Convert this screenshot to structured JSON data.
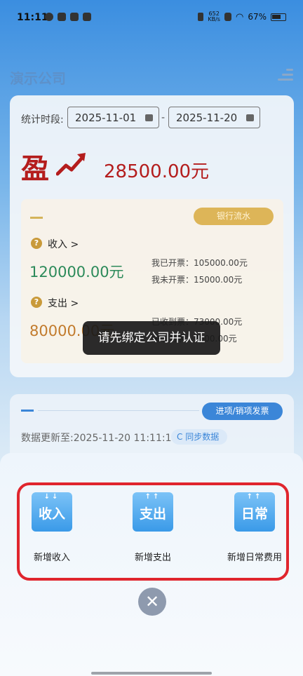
{
  "status_bar": {
    "time": "11:11",
    "net_speed_top": "652",
    "net_speed_bottom": "KB/s",
    "battery": "67%"
  },
  "header": {
    "company": "演示公司"
  },
  "summary": {
    "period_label": "统计时段:",
    "start_date": "2025-11-01",
    "end_date": "2025-11-20",
    "date_separator": "-",
    "profit_char": "盈",
    "profit_value": "28500.00元",
    "bank_statement_label": "银行流水",
    "income": {
      "label": "收入 >",
      "amount": "120000.00元",
      "invoiced": "我已开票：105000.00元",
      "not_invoiced": "我未开票：15000.00元"
    },
    "expense": {
      "label": "支出 >",
      "amount": "80000.00元",
      "received": "已收到票：73000.00元",
      "not_received": "未收到票：7000.00元"
    }
  },
  "toast": {
    "message": "请先绑定公司并认证"
  },
  "invoice_card": {
    "button_label": "进项/销项发票",
    "updated_text": "数据更新至:2025-11-20 11:11:18",
    "sync_label": "C 同步数据"
  },
  "sheet": {
    "actions": [
      {
        "icon_text": "收入",
        "arrows": "↓↓",
        "label": "新增收入",
        "icon": "income-icon"
      },
      {
        "icon_text": "支出",
        "arrows": "↑↑",
        "label": "新增支出",
        "icon": "expense-icon"
      },
      {
        "icon_text": "日常",
        "arrows": "↑↑",
        "label": "新增日常费用",
        "icon": "daily-expense-icon"
      }
    ],
    "close_glyph": "✕"
  },
  "colors": {
    "accent_blue": "#3b86d8",
    "profit_red": "#b41d1d",
    "income_green": "#2c8a5a",
    "expense_orange": "#c27b2d",
    "highlight_frame": "#e0252d"
  }
}
